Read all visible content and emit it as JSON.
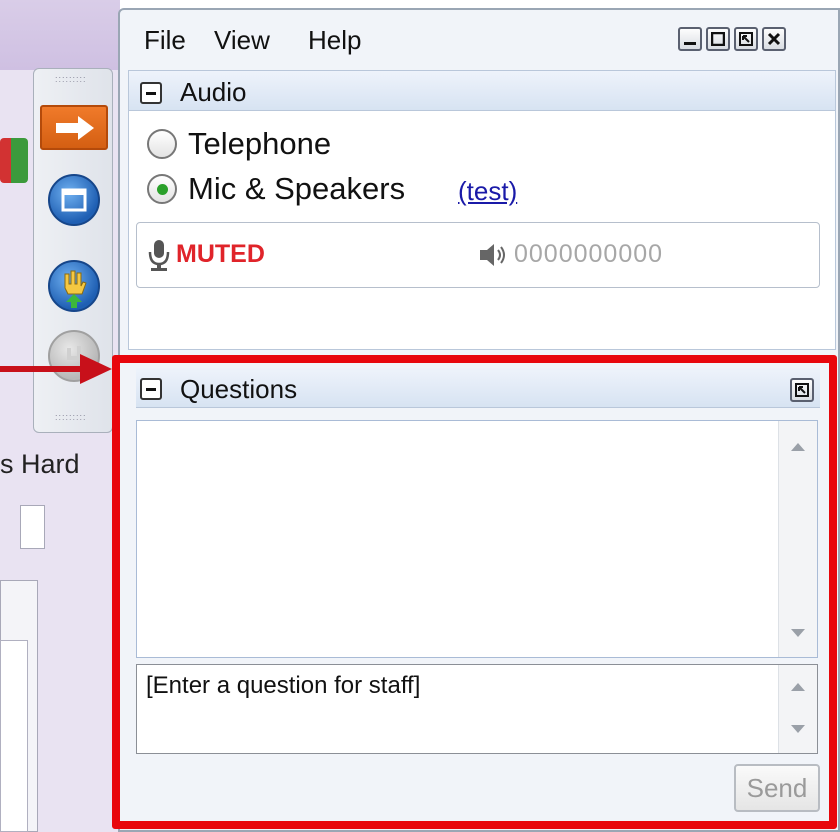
{
  "menubar": {
    "file": "File",
    "view": "View",
    "help": "Help"
  },
  "background_app": {
    "visible_text": "s Hard"
  },
  "audio": {
    "title": "Audio",
    "telephone_label": "Telephone",
    "mic_label": "Mic & Speakers",
    "test_link": "(test)",
    "selected": "Mic & Speakers",
    "muted_label": "MUTED",
    "volume_level": "0000000000"
  },
  "questions": {
    "title": "Questions",
    "input_placeholder": "[Enter a question for staff]",
    "send_label": "Send"
  },
  "colors": {
    "highlight_outline": "#e8060c",
    "muted_text": "#e0242a",
    "link": "#1a1aa8",
    "toolbar_orange": "#e46a1c",
    "toolbar_blue": "#1f5fb3"
  },
  "icons": [
    "minimize-icon",
    "maximize-icon",
    "restore-icon",
    "close-icon",
    "collapse-icon",
    "microphone-icon",
    "speaker-icon",
    "arrow-right-icon",
    "window-icon",
    "raise-hand-icon",
    "popout-icon",
    "scroll-up-icon",
    "scroll-down-icon"
  ]
}
